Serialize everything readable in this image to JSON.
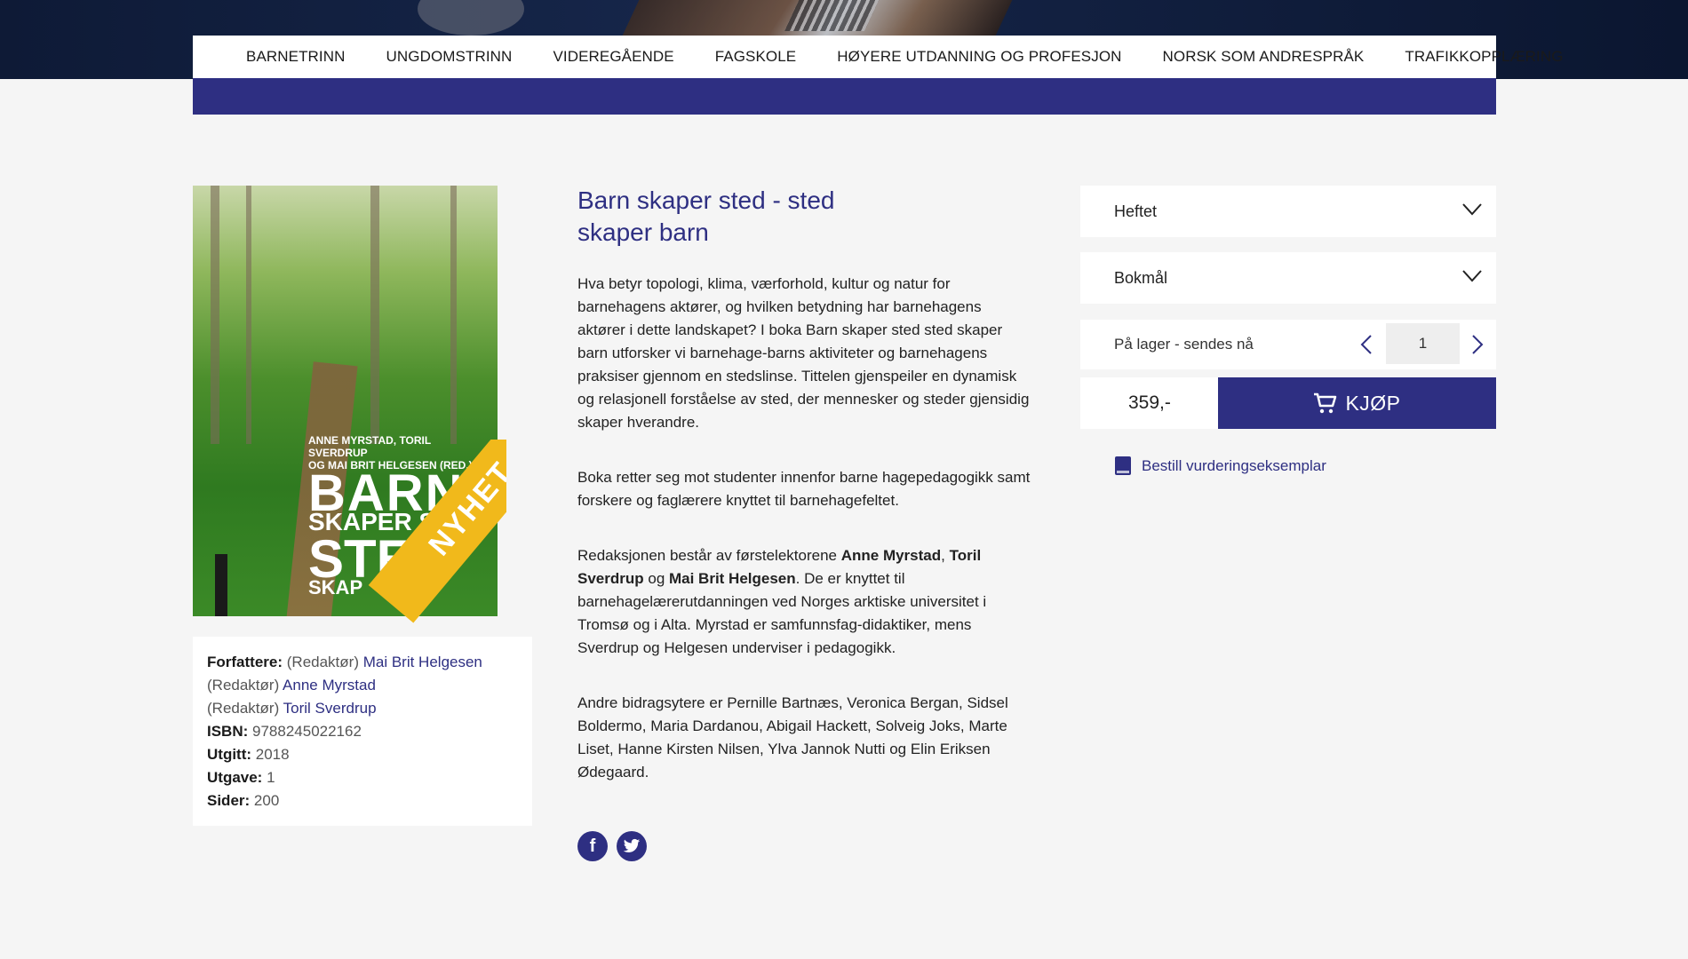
{
  "nav": {
    "items": [
      "BARNETRINN",
      "UNGDOMSTRINN",
      "VIDEREGÅENDE",
      "FAGSKOLE",
      "HØYERE UTDANNING OG PROFESJON",
      "NORSK SOM ANDRESPRÅK",
      "TRAFIKKOPPLÆRING"
    ]
  },
  "cover": {
    "authors_line1": "ANNE MYRSTAD, TORIL SVERDRUP",
    "authors_line2": "OG MAI BRIT HELGESEN (RED.)",
    "title_1": "BARN",
    "title_2": "SKAPER ST",
    "title_3": "STE",
    "title_4": "SKAP",
    "ribbon": "NYHET"
  },
  "meta": {
    "authors_label": "Forfattere:",
    "editor_prefix": "(Redaktør)",
    "author_1": "Mai Brit Helgesen",
    "author_2": "Anne Myrstad",
    "author_3": "Toril Sverdrup",
    "isbn_label": "ISBN:",
    "isbn": "9788245022162",
    "published_label": "Utgitt:",
    "published": "2018",
    "edition_label": "Utgave:",
    "edition": "1",
    "pages_label": "Sider:",
    "pages": "200"
  },
  "product": {
    "title_line1": "Barn skaper sted - sted",
    "title_line2": "skaper barn",
    "p1": "Hva betyr topologi, klima, værforhold, kultur og natur for barnehagens aktører, og hvilken betydning har barnehagens aktører i dette landskapet? I boka Barn skaper sted sted skaper barn utforsker vi barnehage-barns aktiviteter og barnehagens praksiser gjennom en stedslinse. Tittelen gjenspeiler en dynamisk og relasjonell forståelse av sted, der mennesker og steder gjensidig skaper hverandre.",
    "p2": "Boka retter seg mot studenter innenfor barne hagepedagogikk samt forskere og faglærere knyttet til barnehagefeltet.",
    "p3_a": "Redaksjonen består av førstelektorene ",
    "p3_b": "Anne Myrstad",
    "p3_c": ", ",
    "p3_d": "Toril Sverdrup",
    "p3_e": " og ",
    "p3_f": "Mai Brit Helgesen",
    "p3_g": ". De er knyttet til barnehagelærerutdanningen ved Norges arktiske universitet i Tromsø og i Alta. Myrstad er samfunnsfag-didaktiker, mens Sverdrup og Helgesen underviser i pedagogikk.",
    "p4": "Andre bidragsytere er Pernille Bartnæs, Veronica Bergan, Sidsel Boldermo, Maria Dardanou, Abigail Hackett, Solveig Joks, Marte Liset, Hanne Kirsten Nilsen, Ylva Jannok Nutti og Elin Eriksen Ødegaard."
  },
  "purchase": {
    "format": "Heftet",
    "language": "Bokmål",
    "stock": "På lager - sendes nå",
    "quantity": "1",
    "price": "359,-",
    "buy_label": "KJØP",
    "order_sample": "Bestill vurderingseksemplar"
  },
  "colors": {
    "brand": "#2e2f82",
    "ribbon": "#f1b91b"
  },
  "icons": [
    "cart-icon",
    "book-icon",
    "facebook-icon",
    "twitter-icon",
    "chevron-down-icon",
    "chevron-left-icon",
    "chevron-right-icon"
  ]
}
